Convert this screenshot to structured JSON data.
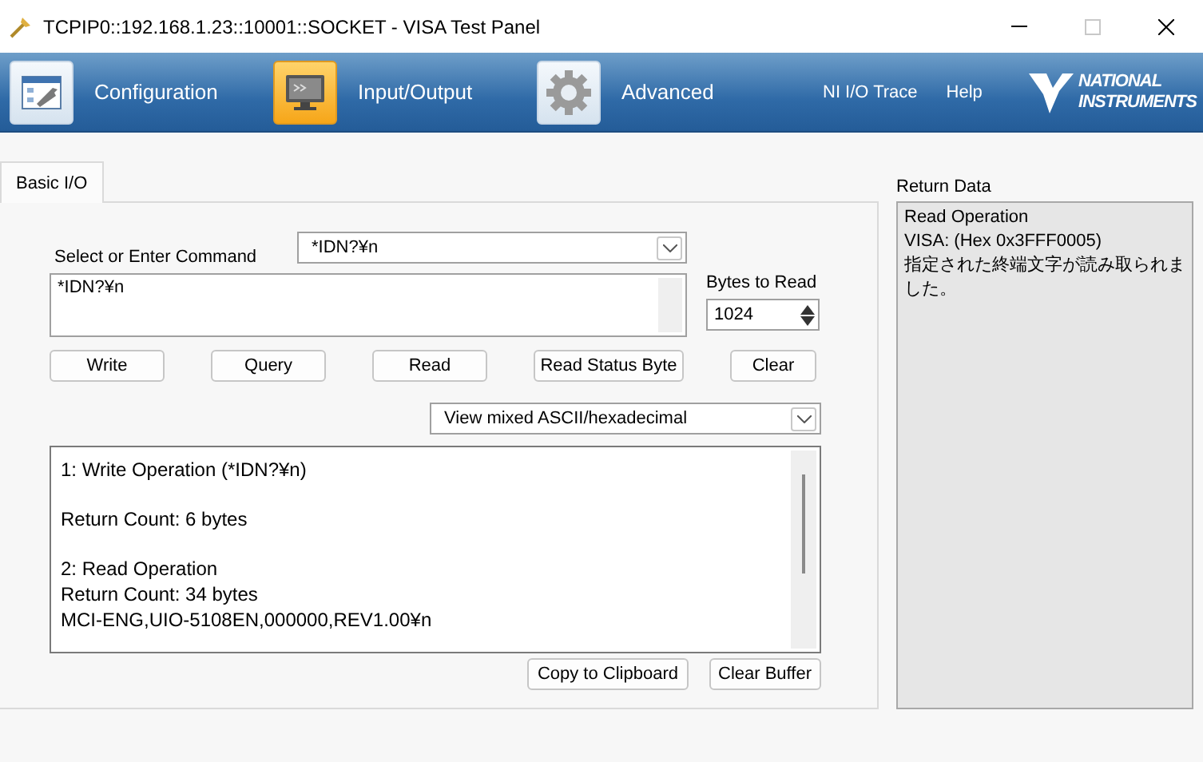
{
  "window": {
    "title": "TCPIP0::192.168.1.23::10001::SOCKET - VISA Test Panel"
  },
  "toolbar": {
    "tabs": [
      {
        "label": "Configuration",
        "kind": "config",
        "selected": false
      },
      {
        "label": "Input/Output",
        "kind": "io",
        "selected": true
      },
      {
        "label": "Advanced",
        "kind": "advanced",
        "selected": false
      }
    ],
    "links": [
      "NI I/O Trace",
      "Help"
    ],
    "logo": [
      "NATIONAL",
      "INSTRUMENTS"
    ]
  },
  "tabs": [
    {
      "label": "Basic I/O",
      "selected": true
    }
  ],
  "command": {
    "label": "Select or Enter Command",
    "combo_value": "*IDN?¥n",
    "text_value": "*IDN?¥n"
  },
  "bytes_to_read": {
    "label": "Bytes to Read",
    "value": "1024"
  },
  "buttons": [
    "Write",
    "Query",
    "Read",
    "Read Status Byte",
    "Clear"
  ],
  "view_mode": {
    "value": "View mixed ASCII/hexadecimal"
  },
  "output_blocks": [
    {
      "lines": [
        "1: Write Operation (*IDN?¥n)"
      ]
    },
    {
      "lines": [
        "Return Count: 6 bytes"
      ]
    },
    {
      "lines": [
        "2: Read Operation",
        "Return Count: 34 bytes",
        "MCI-ENG,UIO-5108EN,000000,REV1.00¥n"
      ]
    }
  ],
  "output_buttons": [
    "Copy to Clipboard",
    "Clear Buffer"
  ],
  "return_data": {
    "label": "Return Data",
    "lines": [
      "Read Operation",
      "VISA:  (Hex 0x3FFF0005)",
      "指定された終端文字が読み取られました。"
    ]
  }
}
